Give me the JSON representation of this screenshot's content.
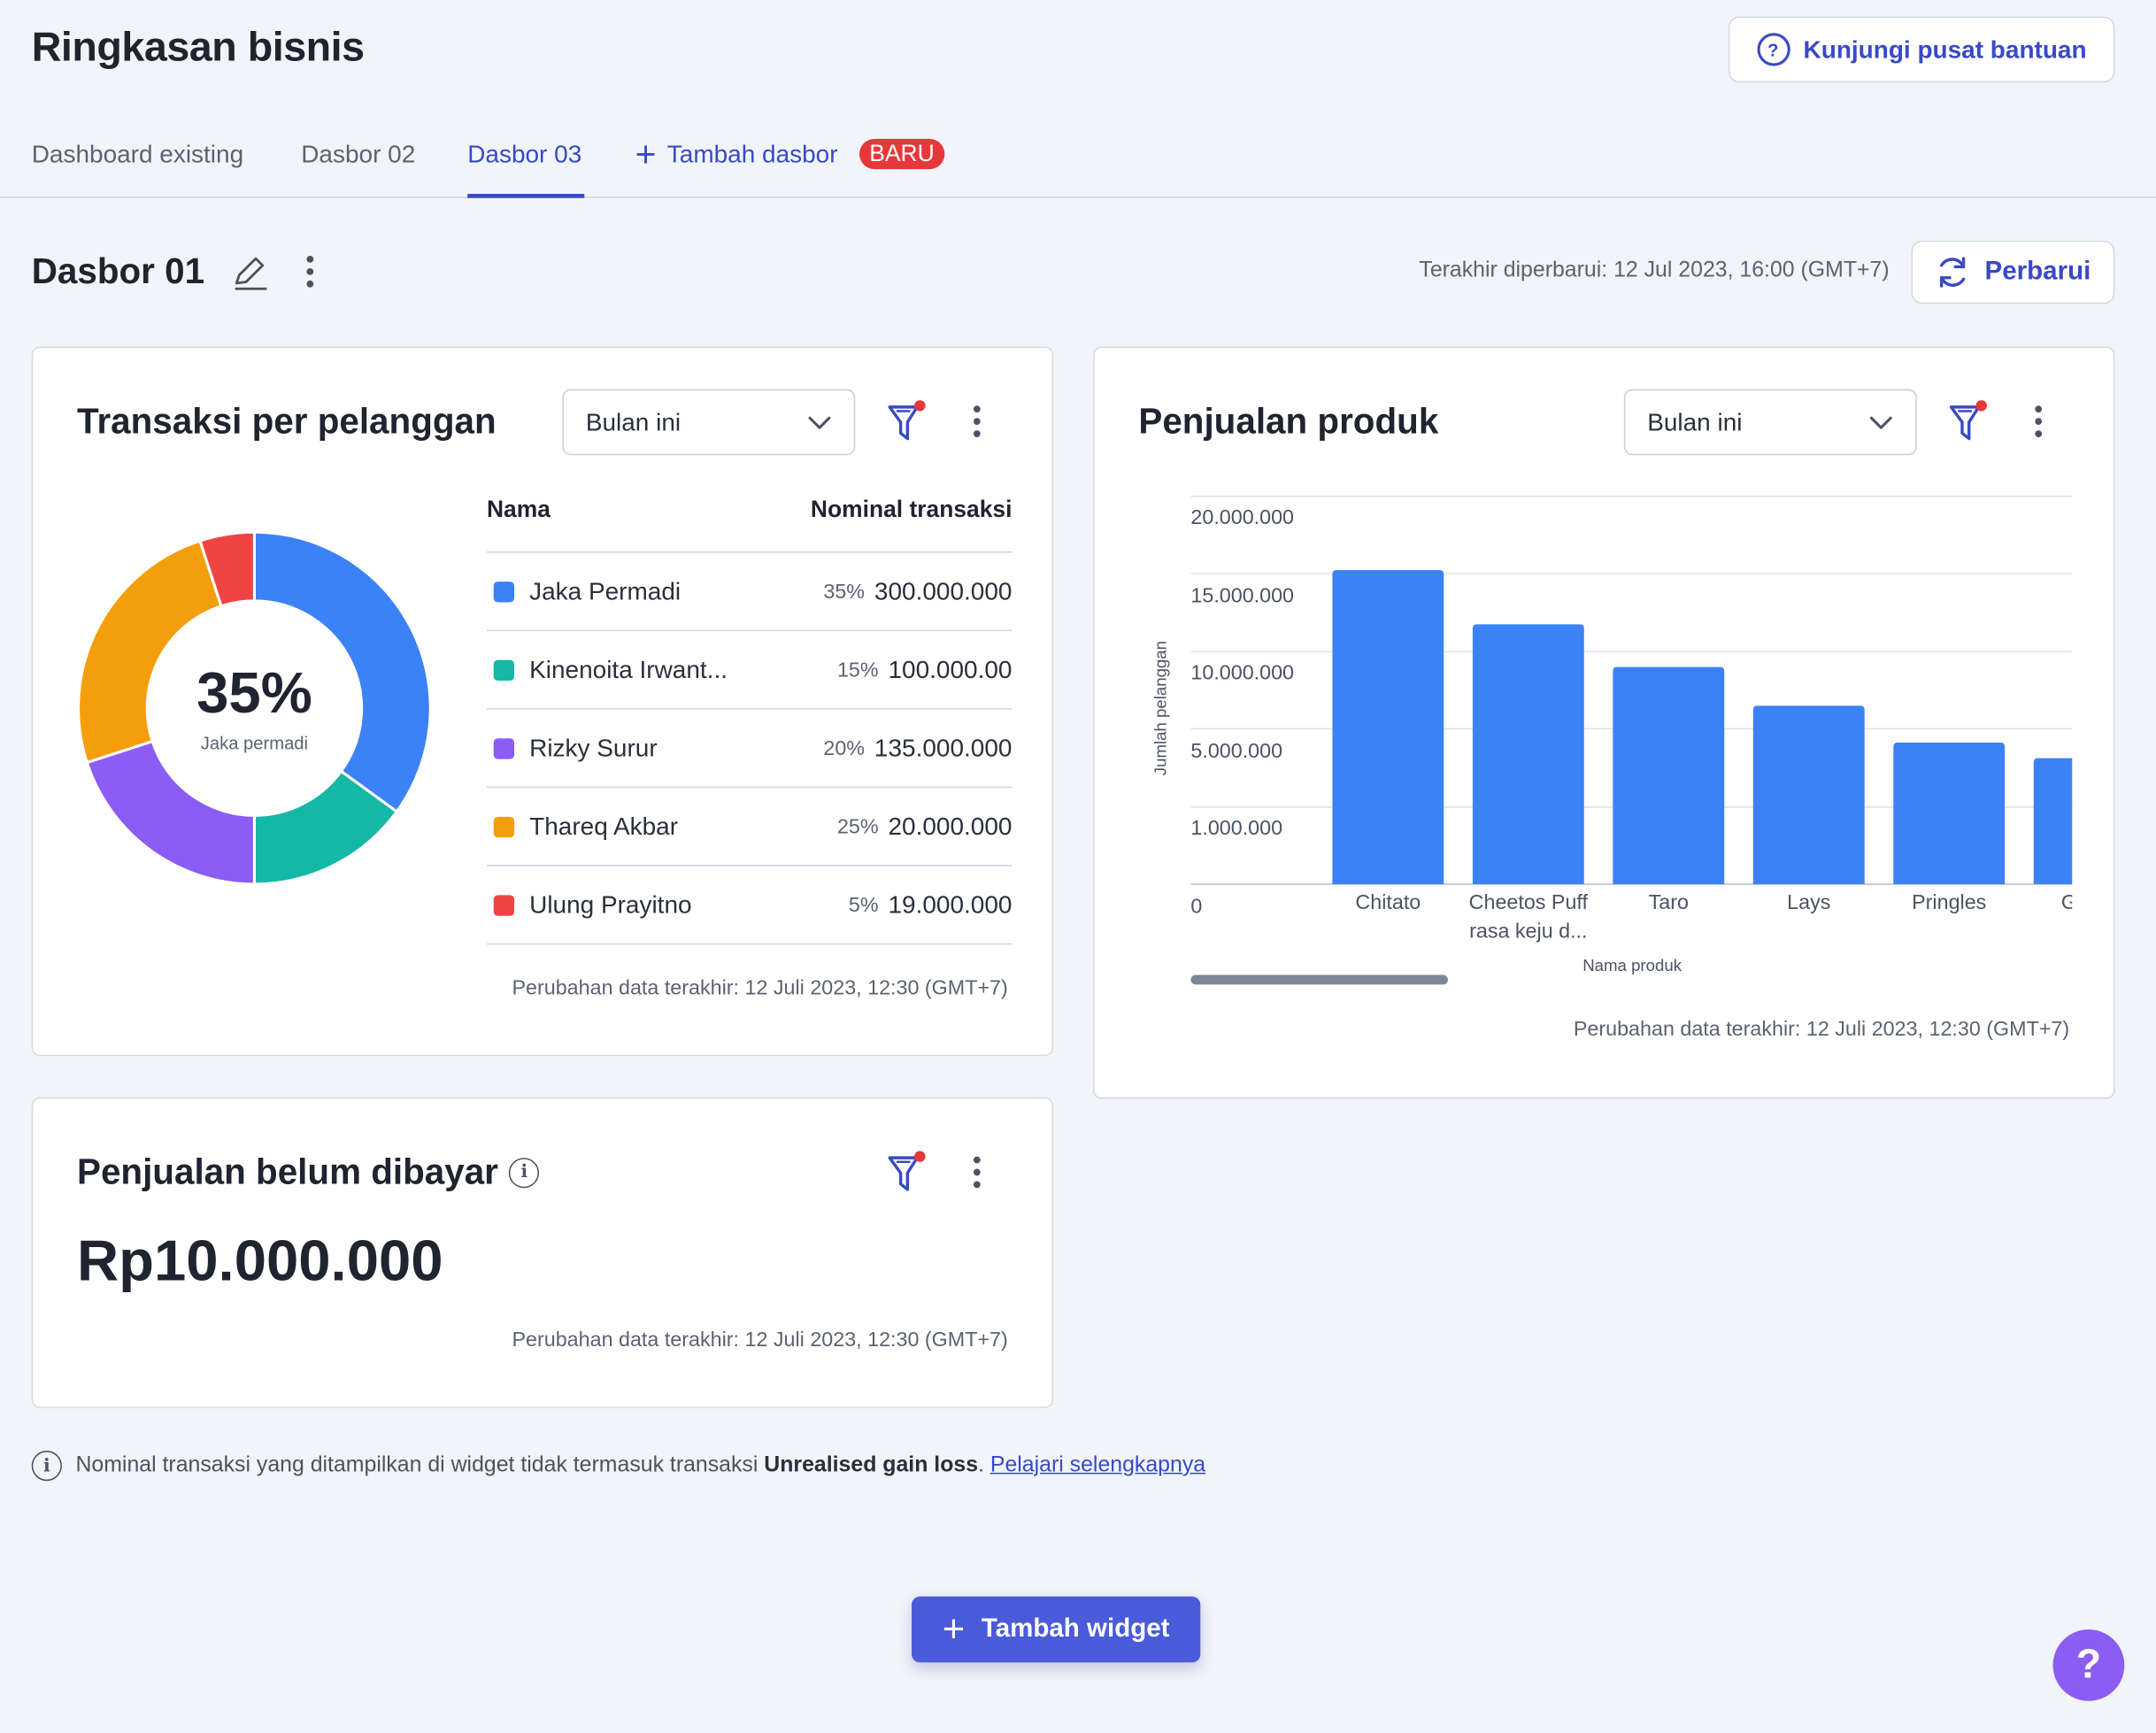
{
  "header": {
    "title": "Ringkasan bisnis",
    "help_button": "Kunjungi pusat bantuan"
  },
  "tabs": [
    {
      "label": "Dashboard existing",
      "active": false
    },
    {
      "label": "Dasbor 02",
      "active": false
    },
    {
      "label": "Dasbor 03",
      "active": true
    }
  ],
  "add_tab": {
    "label": "Tambah dasbor",
    "badge": "BARU"
  },
  "dashboard": {
    "title": "Dasbor 01",
    "last_updated": "Terakhir diperbarui: 12 Jul 2023, 16:00 (GMT+7)",
    "refresh_label": "Perbarui"
  },
  "widget_transactions": {
    "title": "Transaksi per pelanggan",
    "period": "Bulan ini",
    "center_value": "35%",
    "center_label": "Jaka permadi",
    "col_name": "Nama",
    "col_value": "Nominal transaksi",
    "rows": [
      {
        "name": "Jaka Permadi",
        "pct": "35%",
        "value": "300.000.000",
        "color": "#3b82f6"
      },
      {
        "name": "Kinenoita Irwant...",
        "pct": "15%",
        "value": "100.000.00",
        "color": "#14b8a6"
      },
      {
        "name": "Rizky Surur",
        "pct": "20%",
        "value": "135.000.000",
        "color": "#8b5cf6"
      },
      {
        "name": "Thareq Akbar",
        "pct": "25%",
        "value": "20.000.000",
        "color": "#f59e0b"
      },
      {
        "name": "Ulung Prayitno",
        "pct": "5%",
        "value": "19.000.000",
        "color": "#ef4444"
      }
    ],
    "footnote": "Perubahan data terakhir: 12 Juli 2023, 12:30 (GMT+7)"
  },
  "widget_products": {
    "title": "Penjualan produk",
    "period": "Bulan ini",
    "footnote": "Perubahan data terakhir: 12 Juli 2023, 12:30 (GMT+7)"
  },
  "widget_unpaid": {
    "title": "Penjualan belum dibayar",
    "amount": "Rp10.000.000",
    "footnote": "Perubahan data terakhir: 12 Juli 2023, 12:30 (GMT+7)"
  },
  "notice": {
    "text": "Nominal transaksi yang ditampilkan di widget tidak termasuk transaksi",
    "bold": "Unrealised gain loss",
    "link": "Pelajari selengkapnya"
  },
  "add_widget": "Tambah widget",
  "help_fab": "?",
  "colors": {
    "accent": "#3949c7",
    "bar": "#3b82f6",
    "badge": "#e5383b",
    "fab": "#8b5cf6"
  },
  "chart_data": [
    {
      "type": "pie",
      "title": "Transaksi per pelanggan",
      "labels": [
        "Jaka Permadi",
        "Kinenoita Irwant...",
        "Rizky Surur",
        "Thareq Akbar",
        "Ulung Prayitno"
      ],
      "values": [
        35,
        15,
        20,
        25,
        5
      ],
      "colors": [
        "#3b82f6",
        "#14b8a6",
        "#8b5cf6",
        "#f59e0b",
        "#ef4444"
      ]
    },
    {
      "type": "bar",
      "title": "Penjualan produk",
      "xlabel": "Nama produk",
      "ylabel": "Jumlah pelanggan",
      "categories": [
        "Chitato",
        "Cheetos Puff rasa keju d...",
        "Taro",
        "Lays",
        "Pringles",
        "G"
      ],
      "values": [
        16200000,
        13400000,
        11200000,
        9200000,
        7300000,
        6500000
      ],
      "y_ticks": [
        "0",
        "1.000.000",
        "5.000.000",
        "10.000.000",
        "15.000.000",
        "20.000.000"
      ],
      "grid": true
    }
  ]
}
